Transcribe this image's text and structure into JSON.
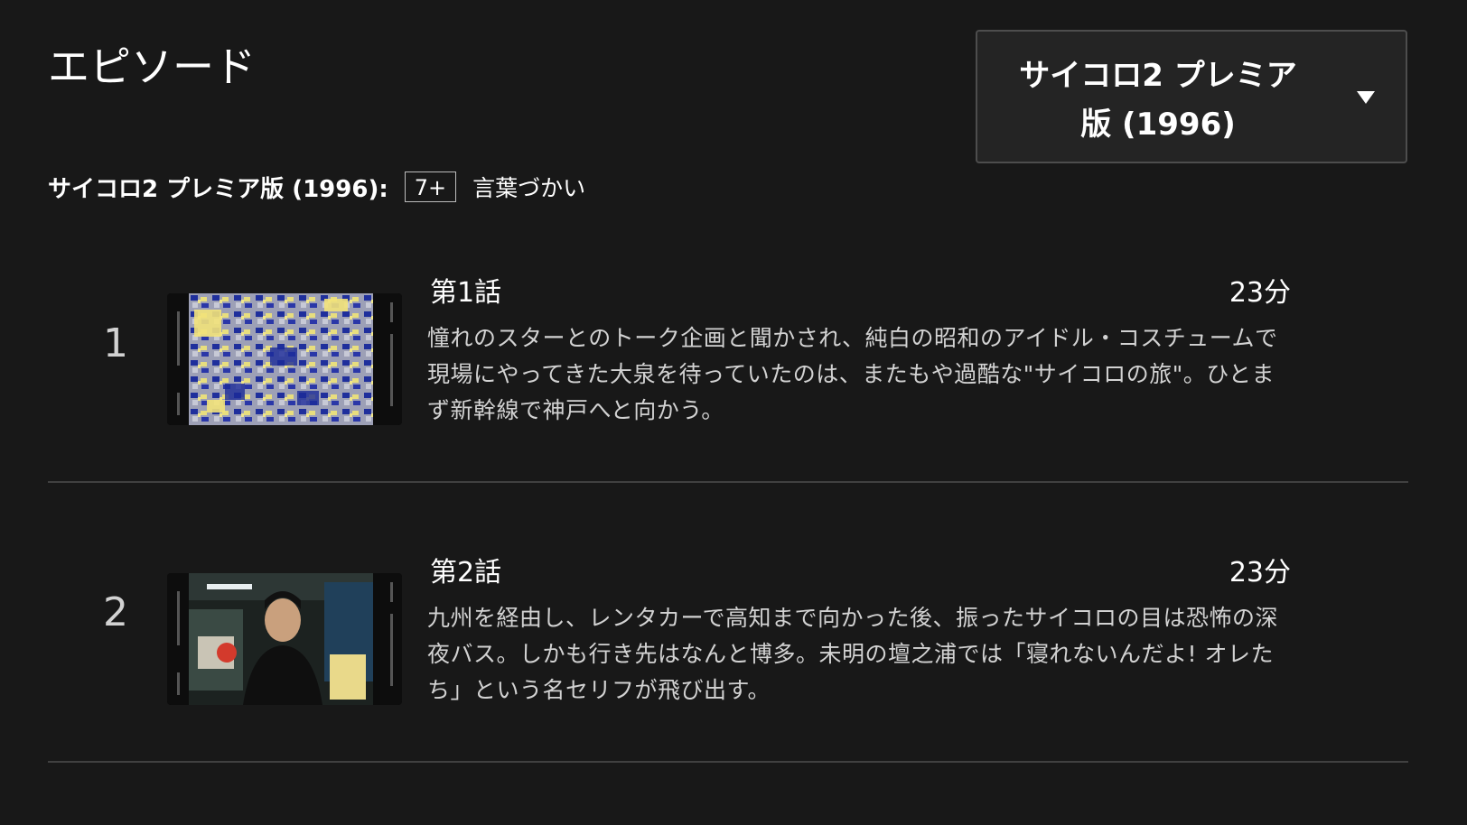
{
  "header": {
    "title": "エピソード"
  },
  "season_selector": {
    "selected": "サイコロ2 プレミア版 (1996)"
  },
  "rating": {
    "season": "サイコロ2 プレミア版 (1996):",
    "badge": "7+",
    "description": "言葉づかい"
  },
  "episodes": [
    {
      "number": "1",
      "title": "第1話",
      "duration": "23分",
      "synopsis": "憧れのスターとのトーク企画と聞かされ、純白の昭和のアイドル・コスチュームで現場にやってきた大泉を待っていたのは、またもや過酷な\"サイコロの旅\"。ひとまず新幹線で神戸へと向かう。"
    },
    {
      "number": "2",
      "title": "第2話",
      "duration": "23分",
      "synopsis": "九州を経由し、レンタカーで高知まで向かった後、振ったサイコロの目は恐怖の深夜バス。しかも行き先はなんと博多。未明の壇之浦では「寝れないんだよ! オレたち」という名セリフが飛び出す。"
    }
  ],
  "colors": {
    "background": "#181818",
    "selector_bg": "#242424",
    "selector_border": "#4d4d4d",
    "divider": "#404040",
    "text_primary": "#ffffff",
    "text_secondary": "#d2d2d2"
  },
  "icons": {
    "season_dropdown": "caret-down-icon"
  }
}
